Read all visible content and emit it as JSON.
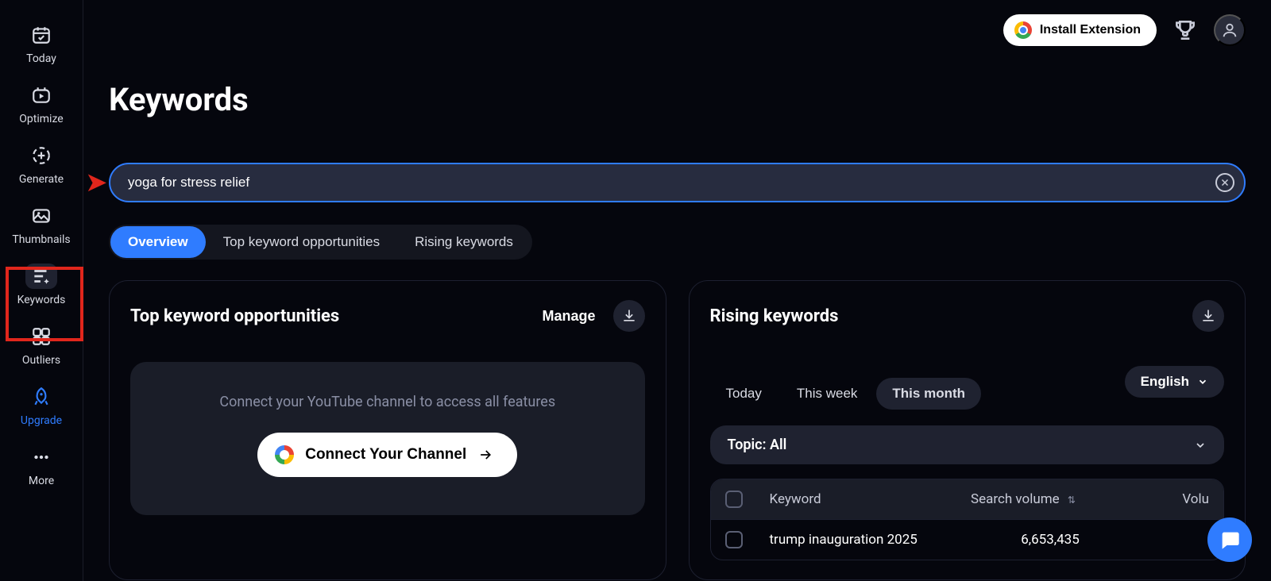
{
  "sidebar": {
    "items": [
      {
        "label": "Today"
      },
      {
        "label": "Optimize"
      },
      {
        "label": "Generate"
      },
      {
        "label": "Thumbnails"
      },
      {
        "label": "Keywords"
      },
      {
        "label": "Outliers"
      },
      {
        "label": "Upgrade"
      },
      {
        "label": "More"
      }
    ]
  },
  "header": {
    "install_label": "Install Extension"
  },
  "page": {
    "title": "Keywords"
  },
  "search": {
    "value": "yoga for stress relief"
  },
  "tabs": [
    {
      "label": "Overview"
    },
    {
      "label": "Top keyword opportunities"
    },
    {
      "label": "Rising keywords"
    }
  ],
  "top_panel": {
    "title": "Top keyword opportunities",
    "manage_label": "Manage",
    "connect_msg": "Connect your YouTube channel to access all features",
    "connect_btn": "Connect Your Channel"
  },
  "rising_panel": {
    "title": "Rising keywords",
    "time": [
      {
        "label": "Today"
      },
      {
        "label": "This week"
      },
      {
        "label": "This month"
      }
    ],
    "lang_label": "English",
    "topic_label": "Topic: All",
    "columns": {
      "keyword": "Keyword",
      "volume": "Search volume",
      "volu": "Volu"
    },
    "rows": [
      {
        "keyword": "trump inauguration 2025",
        "volume": "6,653,435"
      }
    ]
  }
}
